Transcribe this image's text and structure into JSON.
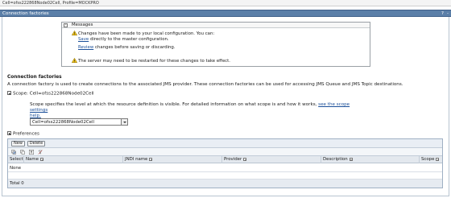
{
  "breadcrumb": "Cell=ofss222868Node02Cell, Profile=MOCKPRO",
  "window": {
    "title": "Connection factories",
    "controls": [
      "?",
      "-"
    ]
  },
  "messages": {
    "header": "Messages",
    "line1": "Changes have been made to your local configuration. You can:",
    "save_link": "Save",
    "save_suffix": " directly to the master configuration.",
    "review_link": "Review",
    "review_suffix": " changes before saving or discarding.",
    "restart_note": "The server may need to be restarted for these changes to take effect."
  },
  "section": {
    "title": "Connection factories",
    "description": "A connection factory is used to create connections to the associated JMS provider. These connection factories can be used for accessing JMS Queue and JMS Topic destinations."
  },
  "scope": {
    "heading": "Scope: Cell=ofss222868Node02Cell",
    "desc_text": "Scope specifies the level at which the resource definition is visible. For detailed information on what scope is and how it works, ",
    "desc_link": "see the scope settings",
    "desc_link2": "help.",
    "selected": "Cell=ofss222868Node02Cell"
  },
  "preferences": {
    "label": "Preferences"
  },
  "buttons": {
    "new": "New",
    "delete": "Delete"
  },
  "toolbar_icons": [
    "select-all-icon",
    "deselect-all-icon",
    "show-filter-icon",
    "clear-filter-icon"
  ],
  "table": {
    "columns": [
      "Select",
      "Name",
      "JNDI name",
      "Provider",
      "Description",
      "Scope"
    ],
    "empty_text": "None",
    "total_text": "Total 0"
  },
  "colors": {
    "title_bar": "#5b7fa8",
    "link": "#1b4f99",
    "header_bg": "#e3e8ee",
    "warning": "#f0c419"
  }
}
